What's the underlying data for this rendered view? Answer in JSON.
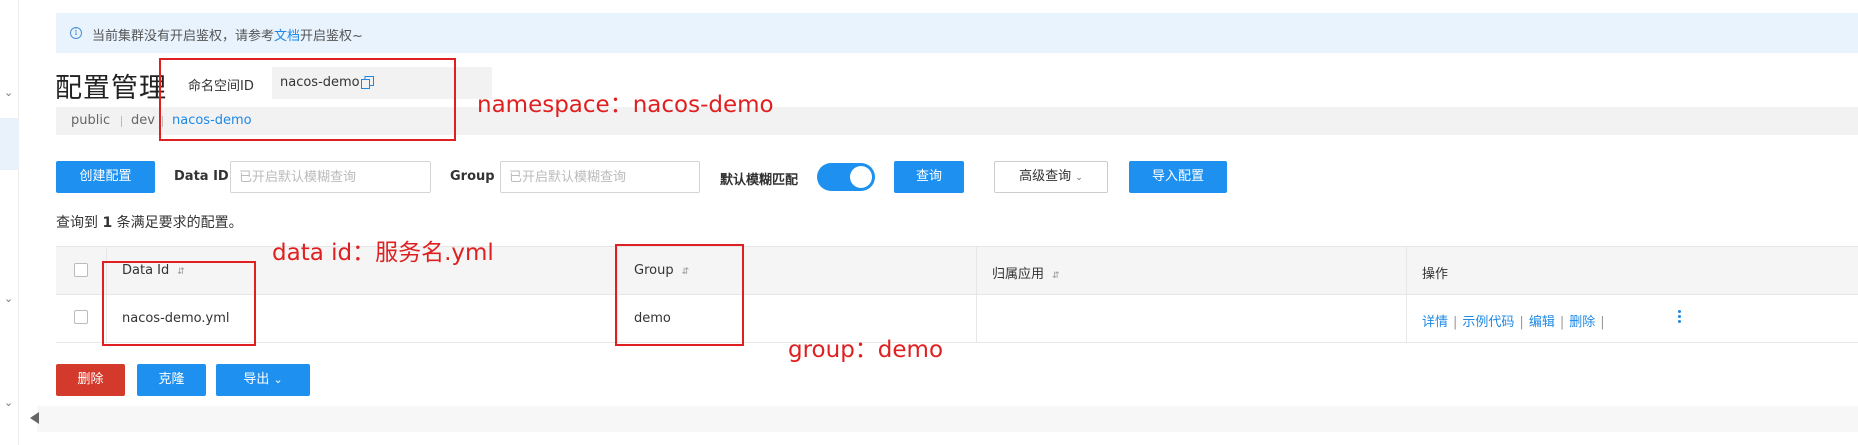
{
  "notice": {
    "text_before": "当前集群没有开启鉴权，请参考",
    "link": "文档",
    "text_after": "开启鉴权~"
  },
  "header": {
    "title": "配置管理",
    "namespace_label": "命名空间ID",
    "namespace_value": "nacos-demo"
  },
  "namespace_tabs": [
    "public",
    "dev",
    "nacos-demo"
  ],
  "toolbar": {
    "create_label": "创建配置",
    "data_id_label": "Data ID",
    "data_id_placeholder": "已开启默认模糊查询",
    "group_label": "Group",
    "group_placeholder": "已开启默认模糊查询",
    "fuzzy_label": "默认模糊匹配",
    "fuzzy_enabled": true,
    "query_label": "查询",
    "advanced_label": "高级查询",
    "import_label": "导入配置"
  },
  "result": {
    "prefix": "查询到",
    "count": "1",
    "suffix": "条满足要求的配置。"
  },
  "table": {
    "columns": [
      "Data Id",
      "Group",
      "归属应用",
      "操作"
    ],
    "rows": [
      {
        "data_id": "nacos-demo.yml",
        "group": "demo",
        "app": ""
      }
    ],
    "actions": [
      "详情",
      "示例代码",
      "编辑",
      "删除"
    ]
  },
  "bulk_actions": {
    "delete_label": "删除",
    "clone_label": "克隆",
    "export_label": "导出"
  },
  "annotations": {
    "namespace": "namespace：nacos-demo",
    "data_id": "data id：服务名.yml",
    "group": "group：demo"
  },
  "colors": {
    "primary": "#1e90ef",
    "danger": "#d33a2b",
    "annotation": "#e02020",
    "notice_bg": "#e8f3fd"
  }
}
